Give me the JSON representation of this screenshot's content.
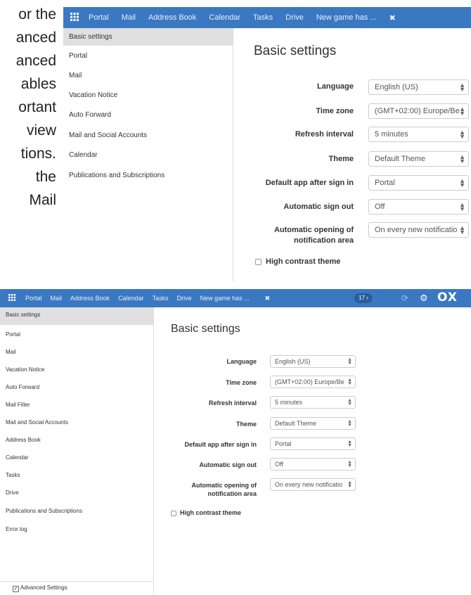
{
  "doc_fragments": [
    "or the",
    "anced",
    "anced",
    "ables",
    "ortant",
    "view",
    "tions.",
    "the",
    "Mail"
  ],
  "topbar": {
    "apps": [
      "Portal",
      "Mail",
      "Address Book",
      "Calendar",
      "Tasks",
      "Drive",
      "New game has ..."
    ],
    "close": "✖",
    "badge": "17",
    "logo": "OX"
  },
  "panel1": {
    "sidebar": [
      "Basic settings",
      "Portal",
      "Mail",
      "Vacation Notice",
      "Auto Forward",
      "Mail and Social Accounts",
      "Calendar",
      "Publications and Subscriptions"
    ]
  },
  "panel2": {
    "sidebar": [
      "Basic settings",
      "Portal",
      "Mail",
      "Vacation Notice",
      "Auto Forward",
      "Mail Filter",
      "Mail and Social Accounts",
      "Address Book",
      "Calendar",
      "Tasks",
      "Drive",
      "Publications and Subscriptions",
      "Error log"
    ],
    "advanced_settings": "Advanced Settings"
  },
  "settings": {
    "title": "Basic settings",
    "language_label": "Language",
    "language_value": "English (US)",
    "timezone_label": "Time zone",
    "timezone_value": "(GMT+02:00) Europe/Be",
    "refresh_label": "Refresh interval",
    "refresh_value": "5 minutes",
    "theme_label": "Theme",
    "theme_value": "Default Theme",
    "defaultapp_label": "Default app after sign in",
    "defaultapp_value": "Portal",
    "signout_label": "Automatic sign out",
    "signout_value": "Off",
    "notif_label_1": "Automatic opening of",
    "notif_label_2": "notification area",
    "notif_value": "On every new notificatio",
    "high_contrast": "High contrast theme"
  },
  "colors": {
    "topbar": "#3a78c2",
    "active_item": "#e0e0e0"
  }
}
